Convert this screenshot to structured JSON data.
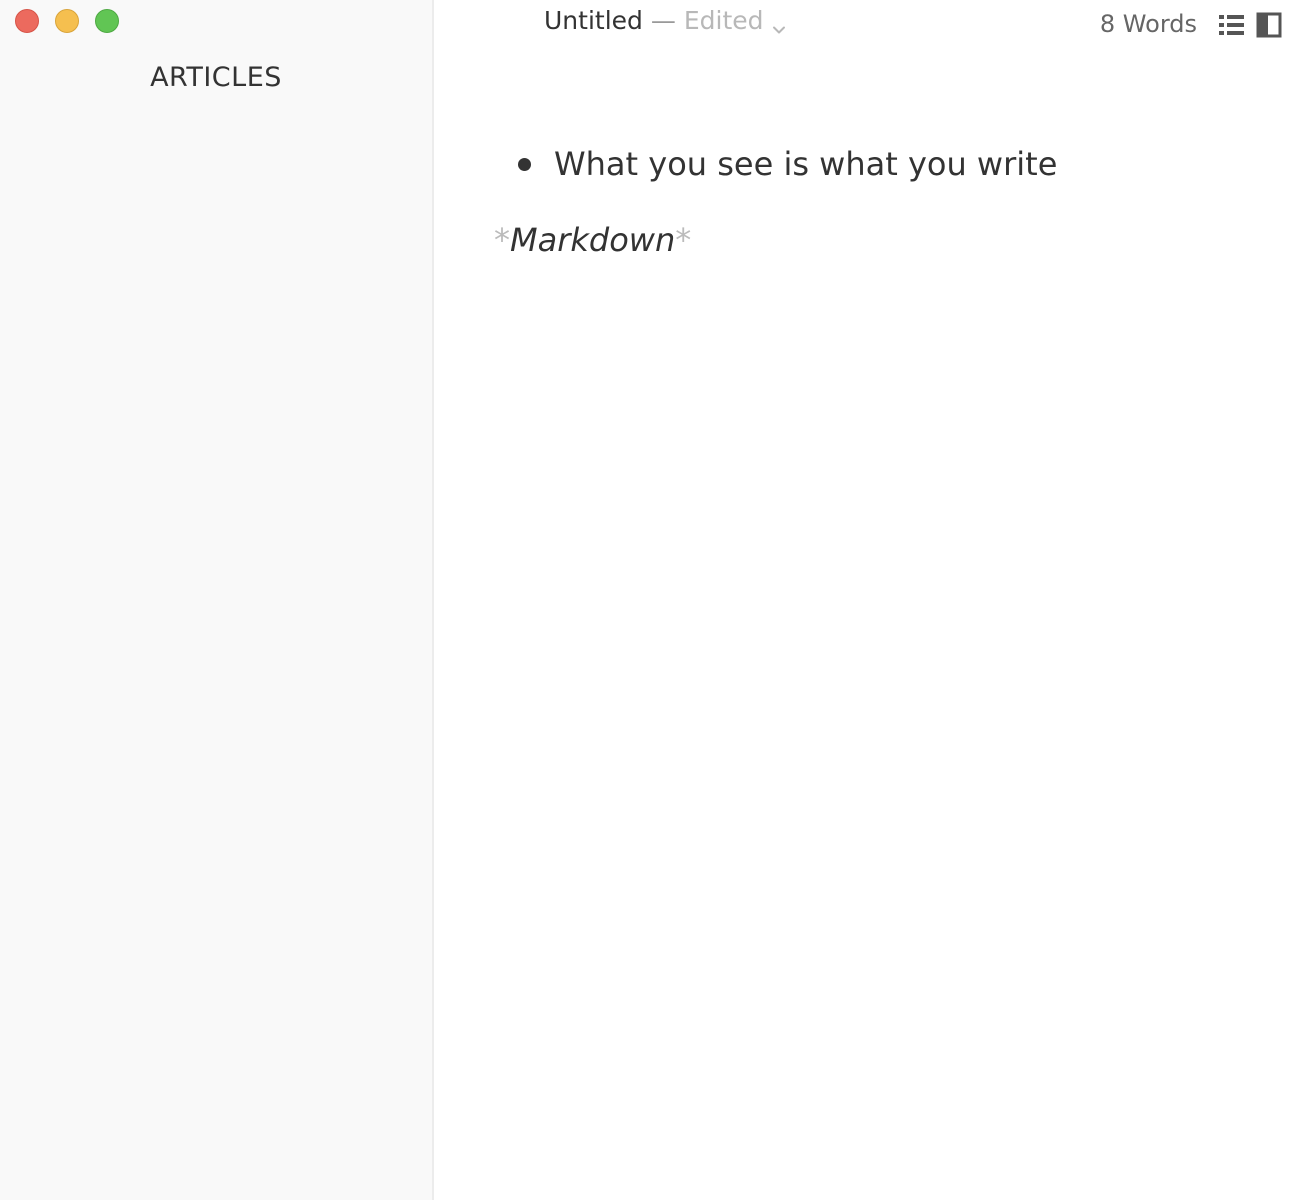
{
  "window": {
    "controls": [
      "close",
      "minimize",
      "zoom"
    ]
  },
  "sidebar": {
    "title": "ARTICLES"
  },
  "titlebar": {
    "document_name": "Untitled",
    "separator": "—",
    "status": "Edited",
    "word_count": "8 Words",
    "icons": [
      "chevron-down-icon",
      "outline-list-icon",
      "toggle-sidebar-icon"
    ]
  },
  "editor": {
    "bullet_items": [
      "What you see is what you write"
    ],
    "markdown_line": {
      "open_marker": "*",
      "text": "Markdown",
      "close_marker": "*"
    }
  },
  "colors": {
    "sidebar_bg": "#f9f9f9",
    "close": "#ec6a5e",
    "minimize": "#f5bf4f",
    "zoom": "#61c554",
    "text": "#333333",
    "muted": "#bbbbbb"
  }
}
